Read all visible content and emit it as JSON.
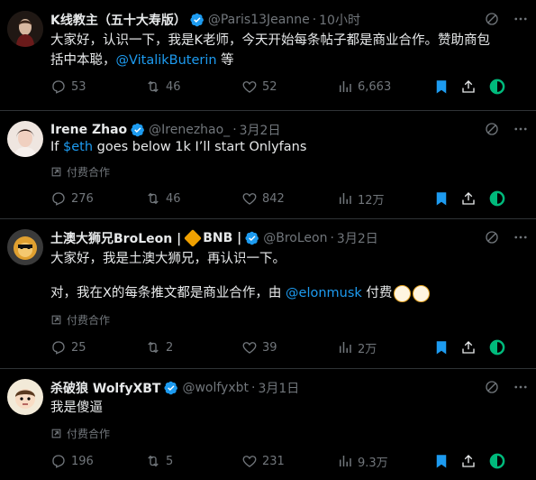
{
  "colors": {
    "accent": "#1d9bf0",
    "muted": "#71767b",
    "text": "#e7e9ea",
    "bookmark": "#1d9bf0",
    "badge_green": "#00ba7c"
  },
  "tweets": [
    {
      "name": "K线教主（五十大寿版）",
      "handle": "@Paris13Jeanne",
      "time": "10小时",
      "text_1": "大家好，认识一下，我是K老师，今天开始每条帖子都是商业合作。赞助商包",
      "text_2a": "括中本聪，",
      "mention": "@VitalikButerin",
      "text_2b": " 等",
      "replies": "53",
      "retweets": "46",
      "likes": "52",
      "views": "6,663"
    },
    {
      "name": "Irene Zhao",
      "handle": "@Irenezhao_",
      "time": "3月2日",
      "text_a": "If ",
      "cashtag": "$eth",
      "text_b": " goes below 1k I’ll start Onlyfans",
      "paid": "付费合作",
      "replies": "276",
      "retweets": "46",
      "likes": "842",
      "views": "12万"
    },
    {
      "name": "土澳大狮兄BroLeon |",
      "badge_text": "BNB |",
      "handle": "@BroLeon",
      "time": "3月2日",
      "text_1": "大家好，我是土澳大狮兄，再认识一下。",
      "text_2a": "对，我在X的每条推文都是商业合作，由 ",
      "mention": "@elonmusk",
      "text_2b": " 付费",
      "paid": "付费合作",
      "replies": "25",
      "retweets": "2",
      "likes": "39",
      "views": "2万"
    },
    {
      "name": "杀破狼 WolfyXBT",
      "handle": "@wolfyxbt",
      "time": "3月1日",
      "text_1": "我是傻逼",
      "paid": "付费合作",
      "replies": "196",
      "retweets": "5",
      "likes": "231",
      "views": "9.3万"
    }
  ]
}
